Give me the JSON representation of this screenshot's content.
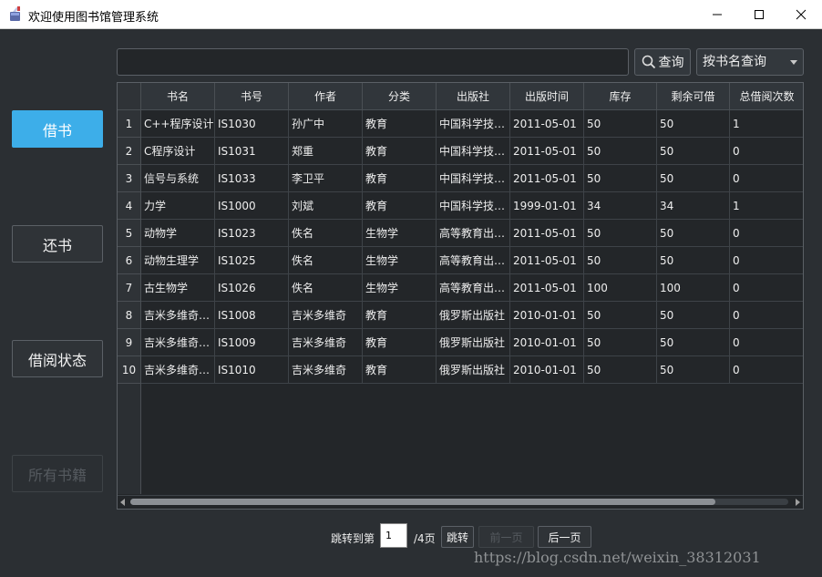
{
  "window": {
    "title": "欢迎使用图书馆管理系统"
  },
  "search": {
    "value": "",
    "placeholder": "",
    "button_label": "查询",
    "mode_selected": "按书名查询"
  },
  "sidebar": {
    "borrow": "借书",
    "return": "还书",
    "status": "借阅状态",
    "all_books": "所有书籍"
  },
  "table": {
    "columns": [
      "书名",
      "书号",
      "作者",
      "分类",
      "出版社",
      "出版时间",
      "库存",
      "剩余可借",
      "总借阅次数"
    ],
    "rows": [
      {
        "num": "1",
        "cells": [
          "C++程序设计",
          "IS1030",
          "孙广中",
          "教育",
          "中国科学技术大学出版社",
          "2011-05-01",
          "50",
          "50",
          "1"
        ]
      },
      {
        "num": "2",
        "cells": [
          "C程序设计",
          "IS1031",
          "郑重",
          "教育",
          "中国科学技术大学出版社",
          "2011-05-01",
          "50",
          "50",
          "0"
        ]
      },
      {
        "num": "3",
        "cells": [
          "信号与系统",
          "IS1033",
          "李卫平",
          "教育",
          "中国科学技术大学出版社",
          "2011-05-01",
          "50",
          "50",
          "0"
        ]
      },
      {
        "num": "4",
        "cells": [
          "力学",
          "IS1000",
          "刘斌",
          "教育",
          "中国科学技术大学出版社",
          "1999-01-01",
          "34",
          "34",
          "1"
        ]
      },
      {
        "num": "5",
        "cells": [
          "动物学",
          "IS1023",
          "佚名",
          "生物学",
          "高等教育出版社",
          "2011-05-01",
          "50",
          "50",
          "0"
        ]
      },
      {
        "num": "6",
        "cells": [
          "动物生理学",
          "IS1025",
          "佚名",
          "生物学",
          "高等教育出版社",
          "2011-05-01",
          "50",
          "50",
          "0"
        ]
      },
      {
        "num": "7",
        "cells": [
          "古生物学",
          "IS1026",
          "佚名",
          "生物学",
          "高等教育出版社",
          "2011-05-01",
          "100",
          "100",
          "0"
        ]
      },
      {
        "num": "8",
        "cells": [
          "吉米多维奇数学分析习题集",
          "IS1008",
          "吉米多维奇",
          "教育",
          "俄罗斯出版社",
          "2010-01-01",
          "50",
          "50",
          "0"
        ]
      },
      {
        "num": "9",
        "cells": [
          "吉米多维奇数学分析习题集",
          "IS1009",
          "吉米多维奇",
          "教育",
          "俄罗斯出版社",
          "2010-01-01",
          "50",
          "50",
          "0"
        ]
      },
      {
        "num": "10",
        "cells": [
          "吉米多维奇数学分析习题集",
          "IS1010",
          "吉米多维奇",
          "教育",
          "俄罗斯出版社",
          "2010-01-01",
          "50",
          "50",
          "0"
        ]
      }
    ]
  },
  "pager": {
    "jump_to_label": "跳转到第",
    "page_value": "1",
    "total_label": "/4页",
    "jump_button": "跳转",
    "prev_button": "前一页",
    "next_button": "后一页"
  },
  "watermark": "https://blog.csdn.net/weixin_38312031",
  "colors": {
    "accent": "#3daee9",
    "background": "#2b2f33",
    "table_bg": "#232629"
  }
}
